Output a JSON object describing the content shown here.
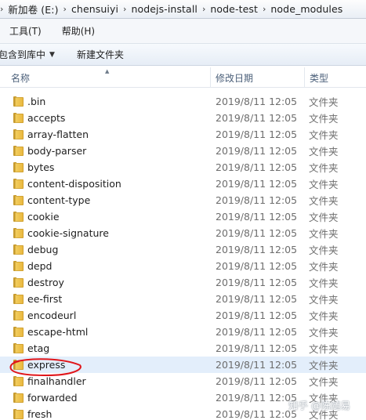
{
  "address_bar": {
    "crumbs": [
      "新加卷 (E:)",
      "chensuiyi",
      "nodejs-install",
      "node-test",
      "node_modules"
    ]
  },
  "menu": {
    "items": [
      "工具(T)",
      "帮助(H)"
    ]
  },
  "toolbar": {
    "include_label": "包含到库中",
    "new_folder_label": "新建文件夹"
  },
  "columns": {
    "name": "名称",
    "date": "修改日期",
    "type": "类型"
  },
  "files": [
    {
      "name": ".bin",
      "date": "2019/8/11 12:05",
      "type": "文件夹"
    },
    {
      "name": "accepts",
      "date": "2019/8/11 12:05",
      "type": "文件夹"
    },
    {
      "name": "array-flatten",
      "date": "2019/8/11 12:05",
      "type": "文件夹"
    },
    {
      "name": "body-parser",
      "date": "2019/8/11 12:05",
      "type": "文件夹"
    },
    {
      "name": "bytes",
      "date": "2019/8/11 12:05",
      "type": "文件夹"
    },
    {
      "name": "content-disposition",
      "date": "2019/8/11 12:05",
      "type": "文件夹"
    },
    {
      "name": "content-type",
      "date": "2019/8/11 12:05",
      "type": "文件夹"
    },
    {
      "name": "cookie",
      "date": "2019/8/11 12:05",
      "type": "文件夹"
    },
    {
      "name": "cookie-signature",
      "date": "2019/8/11 12:05",
      "type": "文件夹"
    },
    {
      "name": "debug",
      "date": "2019/8/11 12:05",
      "type": "文件夹"
    },
    {
      "name": "depd",
      "date": "2019/8/11 12:05",
      "type": "文件夹"
    },
    {
      "name": "destroy",
      "date": "2019/8/11 12:05",
      "type": "文件夹"
    },
    {
      "name": "ee-first",
      "date": "2019/8/11 12:05",
      "type": "文件夹"
    },
    {
      "name": "encodeurl",
      "date": "2019/8/11 12:05",
      "type": "文件夹"
    },
    {
      "name": "escape-html",
      "date": "2019/8/11 12:05",
      "type": "文件夹"
    },
    {
      "name": "etag",
      "date": "2019/8/11 12:05",
      "type": "文件夹"
    },
    {
      "name": "express",
      "date": "2019/8/11 12:05",
      "type": "文件夹",
      "selected": true
    },
    {
      "name": "finalhandler",
      "date": "2019/8/11 12:05",
      "type": "文件夹"
    },
    {
      "name": "forwarded",
      "date": "2019/8/11 12:05",
      "type": "文件夹"
    },
    {
      "name": "fresh",
      "date": "2019/8/11 12:05",
      "type": "文件夹"
    }
  ],
  "annotation_color": "#e0161b",
  "watermark": "知乎 @陈随易"
}
